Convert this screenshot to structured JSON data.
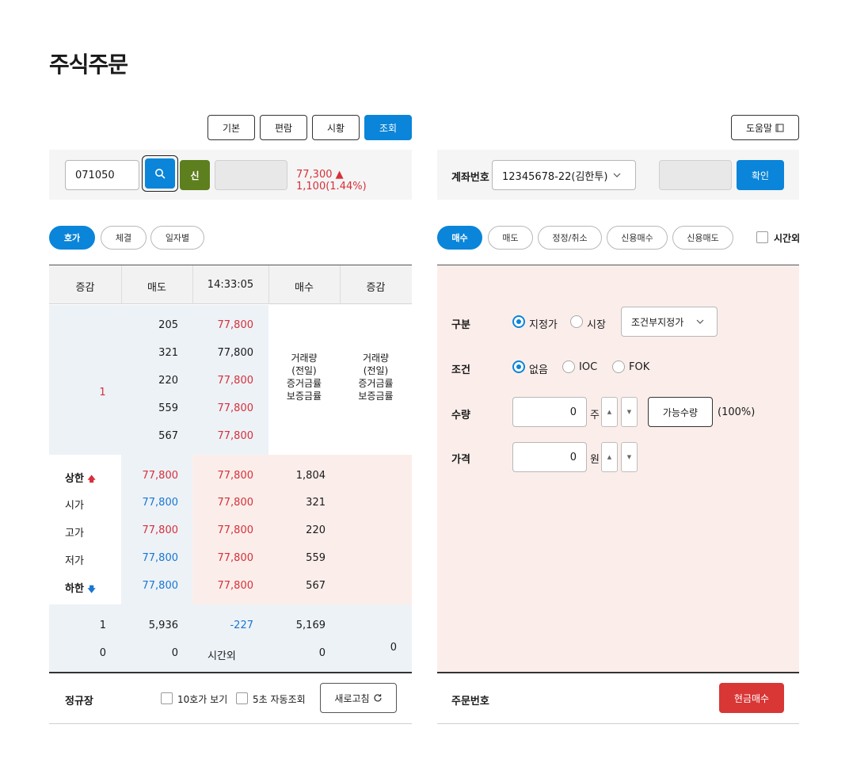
{
  "page": {
    "title": "주식주문"
  },
  "left": {
    "view_buttons": [
      "기본",
      "편람",
      "시황",
      "조회"
    ],
    "stock_code": "071050",
    "credit_label": "신",
    "price_info": "77,300 ▲ 1,100(1.44%)",
    "tabs": [
      "호가",
      "체결",
      "일자별"
    ],
    "table": {
      "headers": [
        "증감",
        "매도",
        "14:33:05",
        "매수",
        "증감"
      ],
      "ask_change": "1",
      "ask_rows": [
        {
          "volume": "205",
          "price": "77,800"
        },
        {
          "volume": "321",
          "price": "77,800"
        },
        {
          "volume": "220",
          "price": "77,800"
        },
        {
          "volume": "559",
          "price": "77,800"
        },
        {
          "volume": "567",
          "price": "77,800"
        }
      ],
      "bid_info": [
        "거래량",
        "(전일)",
        "증거금률",
        "보증금률"
      ],
      "change_info": [
        "거래량",
        "(전일)",
        "증거금률",
        "보증금률"
      ],
      "summary_rows": [
        {
          "label": "상한",
          "sell": "77,800",
          "price": "77,800",
          "buy": "1,804"
        },
        {
          "label": "시가",
          "sell": "77,800",
          "price": "77,800",
          "buy": "321"
        },
        {
          "label": "고가",
          "sell": "77,800",
          "price": "77,800",
          "buy": "220"
        },
        {
          "label": "저가",
          "sell": "77,800",
          "price": "77,800",
          "buy": "559"
        },
        {
          "label": "하한",
          "sell": "77,800",
          "price": "77,800",
          "buy": "567"
        }
      ],
      "totals": [
        {
          "change": "1",
          "sell": "5,936",
          "mid": "-227",
          "buy": "5,169"
        },
        {
          "change": "0",
          "sell": "0",
          "mid": "시간외",
          "buy": "0"
        }
      ],
      "bid_change_total": "0"
    },
    "footer": {
      "market": "정규장",
      "show_10": "10호가 보기",
      "auto_refresh": "5초 자동조회",
      "refresh_button": "새로고침"
    }
  },
  "right": {
    "help_button": "도움말",
    "account_label": "계좌번호",
    "account_value": "12345678-22(김한투)",
    "confirm_button": "확인",
    "tabs": [
      "매수",
      "매도",
      "정정/취소",
      "신용매수",
      "신용매도"
    ],
    "after_hours": "시간외",
    "form": {
      "type_label": "구분",
      "type_options": [
        "지정가",
        "시장"
      ],
      "type_select": "조건부지정가",
      "cond_label": "조건",
      "cond_options": [
        "없음",
        "IOC",
        "FOK"
      ],
      "qty_label": "수량",
      "qty_value": "0",
      "qty_unit": "주",
      "avail_button": "가능수량",
      "avail_pct": "(100%)",
      "price_label": "가격",
      "price_value": "0",
      "price_unit": "원"
    },
    "footer": {
      "order_no_label": "주문번호",
      "buy_button": "현금매수"
    }
  }
}
